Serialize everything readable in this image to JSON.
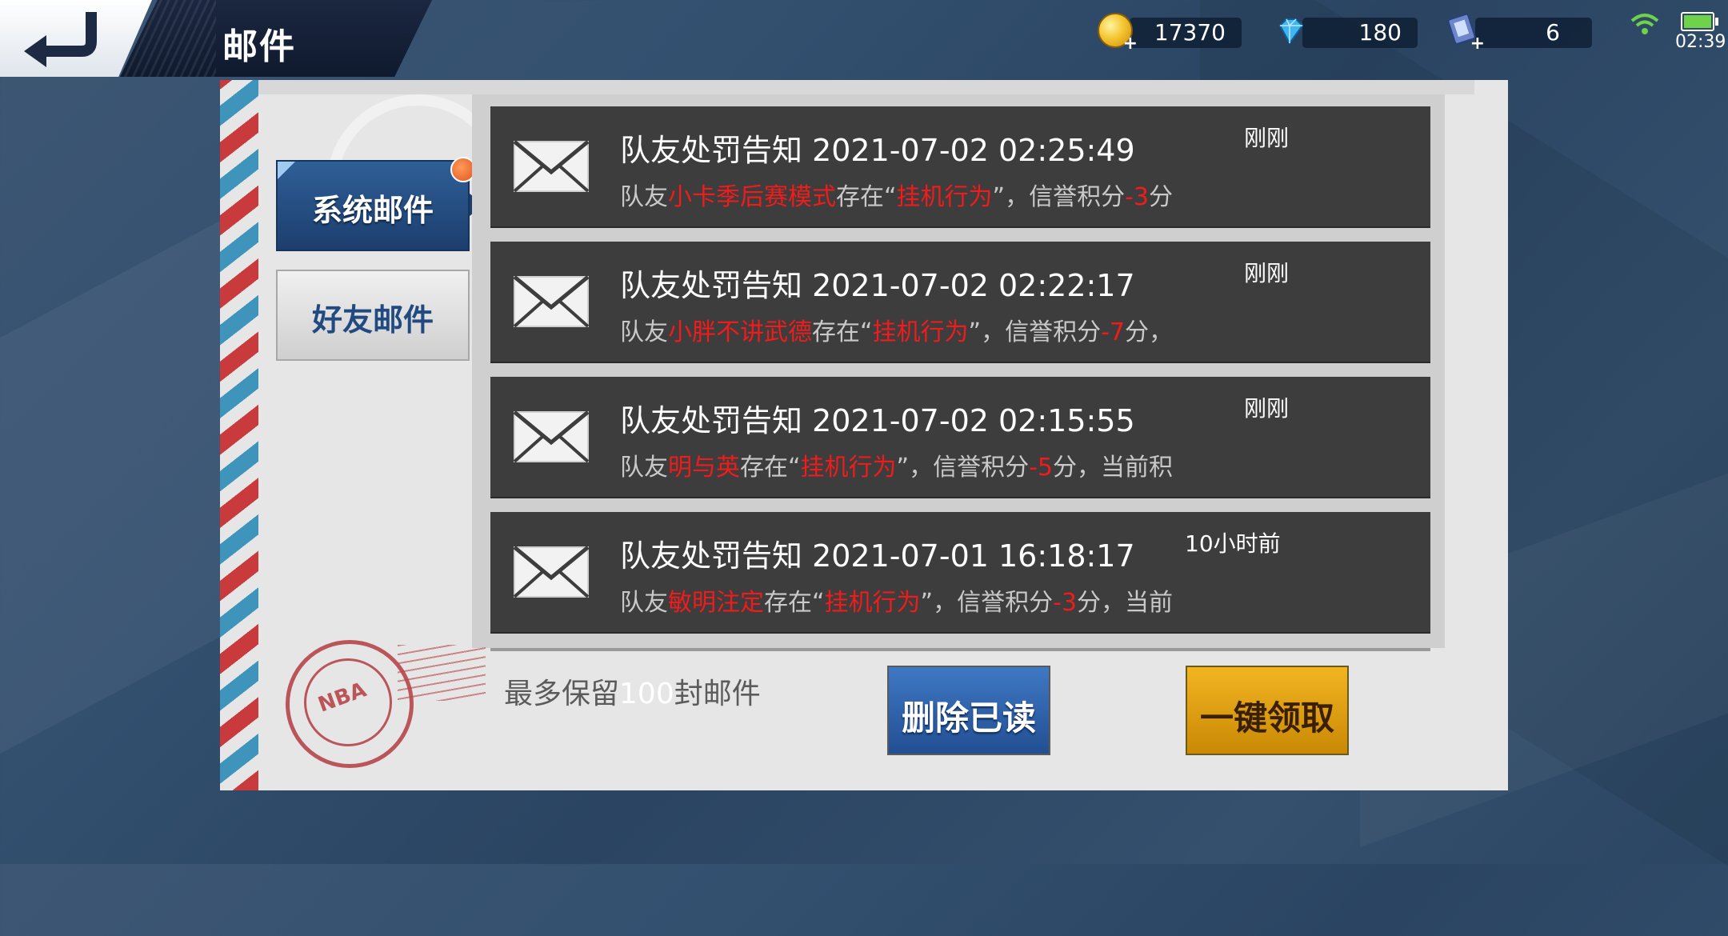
{
  "header": {
    "title": "邮件",
    "back_icon": "back-arrow-icon"
  },
  "resources": [
    {
      "name": "coins",
      "icon": "gold-coin-icon",
      "value": "17370"
    },
    {
      "name": "diamonds",
      "icon": "diamond-icon",
      "value": "180"
    },
    {
      "name": "tickets",
      "icon": "ticket-icon",
      "value": "6"
    }
  ],
  "status_bar": {
    "time": "02:39",
    "wifi_icon": "wifi-icon",
    "battery_icon": "battery-icon"
  },
  "tabs": [
    {
      "label": "系统邮件",
      "selected": true
    },
    {
      "label": "好友邮件",
      "selected": false
    }
  ],
  "mails": [
    {
      "title": "队友处罚告知 2021-07-02 02:25:49",
      "time_ago": "刚刚",
      "body": {
        "p1": "队友",
        "player": "小卡季后赛模式",
        "p2": "存在“",
        "behavior": "挂机行为",
        "p3": "”，信誉积分",
        "delta": "-3",
        "p4": "分"
      }
    },
    {
      "title": "队友处罚告知 2021-07-02 02:22:17",
      "time_ago": "刚刚",
      "body": {
        "p1": "队友",
        "player": "小胖不讲武德",
        "p2": "存在“",
        "behavior": "挂机行为",
        "p3": "”，信誉积分",
        "delta": "-7",
        "p4": "分，"
      }
    },
    {
      "title": "队友处罚告知 2021-07-02 02:15:55",
      "time_ago": "刚刚",
      "body": {
        "p1": "队友",
        "player": "明与英",
        "p2": "存在“",
        "behavior": "挂机行为",
        "p3": "”，信誉积分",
        "delta": "-5",
        "p4": "分，当前积"
      }
    },
    {
      "title": "队友处罚告知 2021-07-01 16:18:17",
      "time_ago": "10小时前",
      "body": {
        "p1": "队友",
        "player": "敏明注定",
        "p2": "存在“",
        "behavior": "挂机行为",
        "p3": "”，信誉积分",
        "delta": "-3",
        "p4": "分，当前"
      }
    }
  ],
  "footer": {
    "note_prefix": "最多保留",
    "note_count": "100",
    "note_suffix": "封邮件",
    "stamp_text": "NBA",
    "delete_read_label": "删除已读",
    "claim_all_label": "一键领取"
  },
  "colors": {
    "accent_red": "#f11b1b",
    "tab_selected": "#1c3e6e",
    "claim_gold": "#e3a614",
    "delete_blue": "#3166ad"
  }
}
